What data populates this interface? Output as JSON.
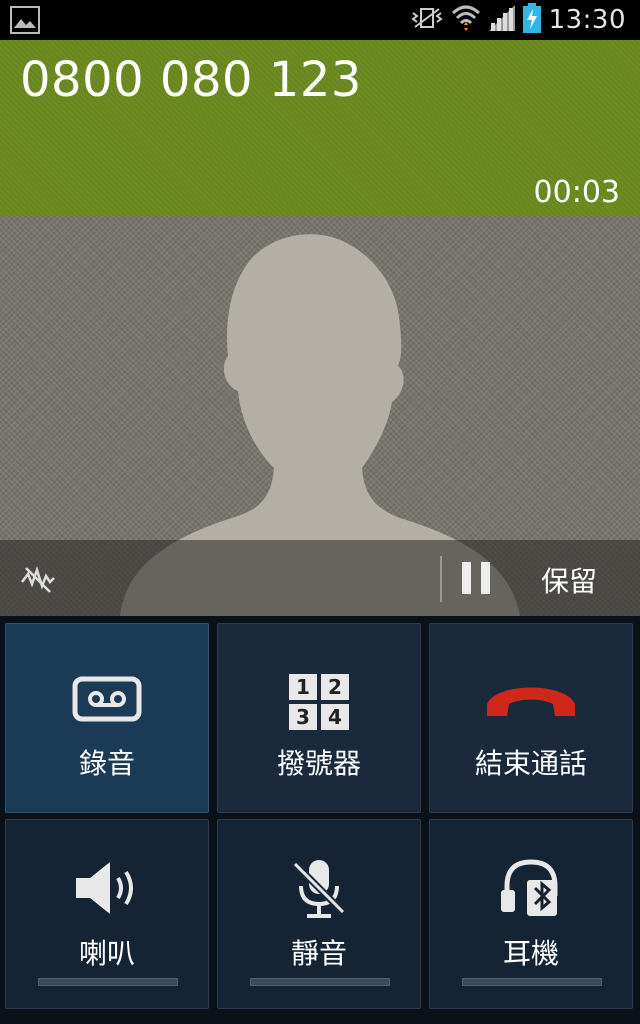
{
  "status_bar": {
    "time": "13:30",
    "icons": [
      "image-notification-icon",
      "vibrate-icon",
      "wifi-icon",
      "signal-icon",
      "battery-charging-icon"
    ]
  },
  "call": {
    "number": "0800 080 123",
    "duration": "00:03"
  },
  "hold_bar": {
    "noise_icon": "noise-reduction-off-icon",
    "hold_label": "保留"
  },
  "buttons": [
    {
      "label": "錄音",
      "icon": "record-tape-icon",
      "active": true
    },
    {
      "label": "撥號器",
      "icon": "keypad-icon",
      "keys": [
        "1",
        "2",
        "3",
        "4"
      ]
    },
    {
      "label": "結束通話",
      "icon": "end-call-icon",
      "color": "#d0271b"
    },
    {
      "label": "喇叭",
      "icon": "speaker-icon"
    },
    {
      "label": "靜音",
      "icon": "mute-mic-icon"
    },
    {
      "label": "耳機",
      "icon": "bluetooth-headset-icon"
    }
  ],
  "colors": {
    "header": "#6b8a1f",
    "end_call": "#d0271b",
    "button_bg": "#1a2a3c",
    "active_button_bg": "#1b3a55"
  }
}
